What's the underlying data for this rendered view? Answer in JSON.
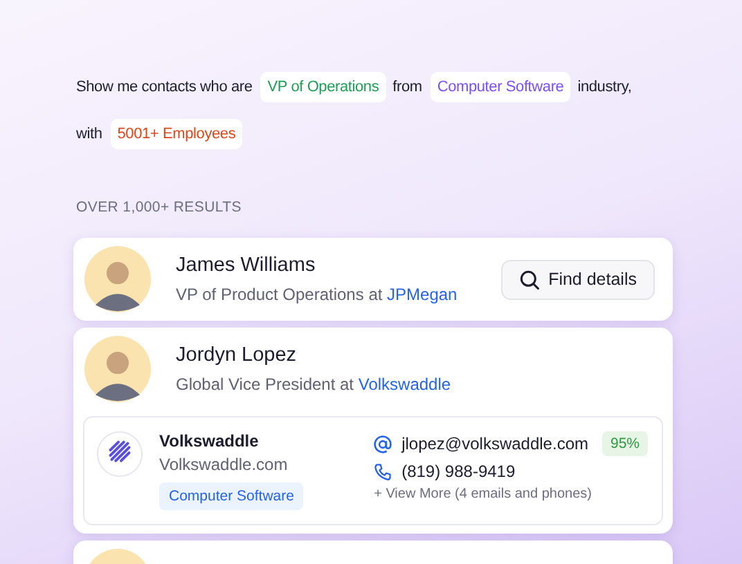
{
  "query": [
    {
      "kind": "text",
      "text": "Show me contacts who are"
    },
    {
      "kind": "chip",
      "text": "VP of Operations",
      "color": "#1f9d55"
    },
    {
      "kind": "text",
      "text": "from"
    },
    {
      "kind": "chip",
      "text": "Computer Software",
      "color": "#7c4dff"
    },
    {
      "kind": "text",
      "text": "industry,"
    },
    {
      "kind": "break"
    },
    {
      "kind": "text",
      "text": "with"
    },
    {
      "kind": "chip",
      "text": "5001+ Employees",
      "color": "#e0461b"
    }
  ],
  "results_label": "OVER 1,000+ RESULTS",
  "contacts": [
    {
      "name": "James Williams",
      "title": "VP of Product Operations at",
      "company": "JPMegan",
      "expanded": false,
      "action": "Find details"
    },
    {
      "name": "Jordyn Lopez",
      "title": "Global Vice President at",
      "company": "Volkswaddle",
      "expanded": true,
      "details": {
        "company": "Volkswaddle",
        "domain": "Volkswaddle.com",
        "industry": "Computer Software",
        "email": "jlopez@volkswaddle.com",
        "confidence": "95%",
        "phone": "(819) 988-9419",
        "more": "+ View More (4 emails and phones)"
      }
    }
  ]
}
